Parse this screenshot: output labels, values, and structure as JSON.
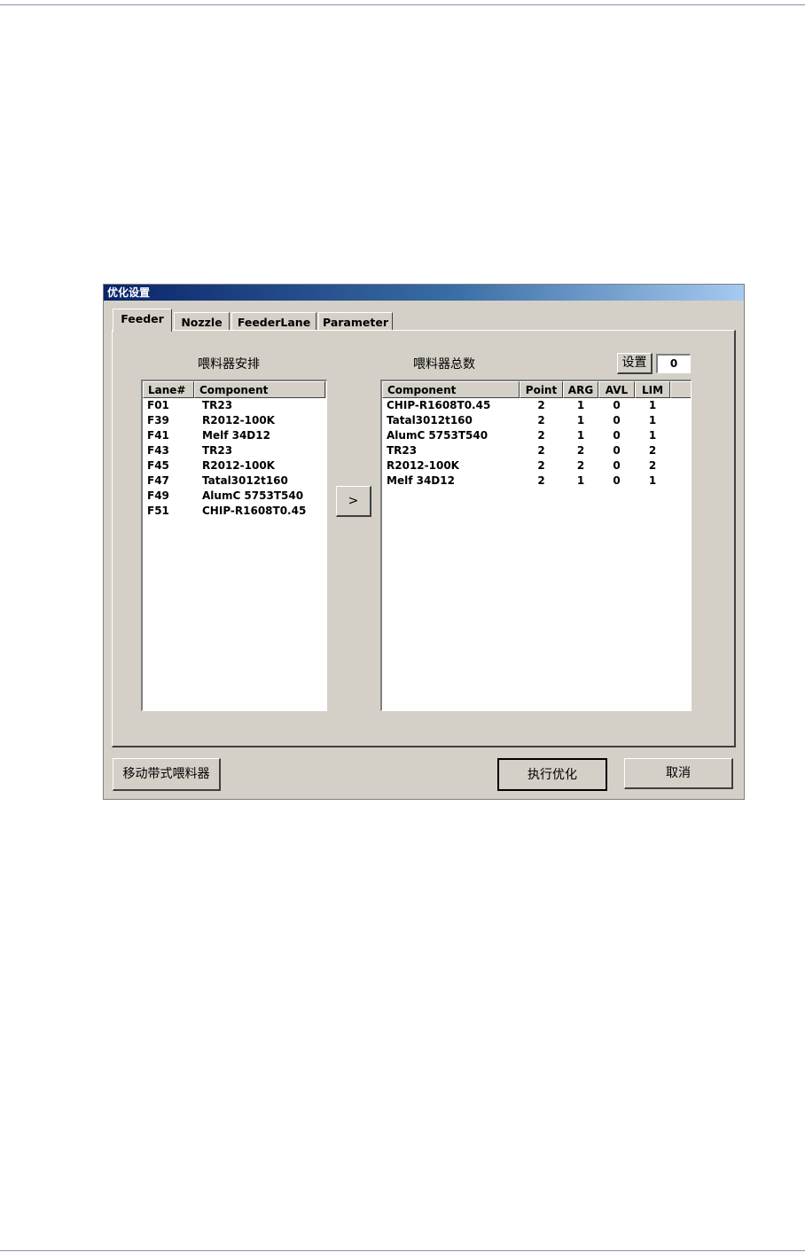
{
  "window": {
    "title": "优化设置"
  },
  "tabs": [
    {
      "label": "Feeder",
      "active": true
    },
    {
      "label": "Nozzle",
      "active": false
    },
    {
      "label": "FeederLane",
      "active": false
    },
    {
      "label": "Parameter",
      "active": false
    }
  ],
  "feeder_arrangement": {
    "caption": "喂料器安排",
    "columns": [
      "Lane#",
      "Component"
    ],
    "rows": [
      {
        "lane": "F01",
        "component": "TR23"
      },
      {
        "lane": "F39",
        "component": "R2012-100K"
      },
      {
        "lane": "F41",
        "component": "Melf 34D12"
      },
      {
        "lane": "F43",
        "component": "TR23"
      },
      {
        "lane": "F45",
        "component": "R2012-100K"
      },
      {
        "lane": "F47",
        "component": "Tatal3012t160"
      },
      {
        "lane": "F49",
        "component": "AlumC 5753T540"
      },
      {
        "lane": "F51",
        "component": "CHIP-R1608T0.45"
      }
    ]
  },
  "move_button": {
    "label": ">"
  },
  "feeder_totals": {
    "caption": "喂料器总数",
    "set_button": "设置",
    "set_value": "0",
    "columns": [
      "Component",
      "Point",
      "ARG",
      "AVL",
      "LIM"
    ],
    "rows": [
      {
        "component": "CHIP-R1608T0.45",
        "point": "2",
        "arg": "1",
        "avl": "0",
        "lim": "1"
      },
      {
        "component": "Tatal3012t160",
        "point": "2",
        "arg": "1",
        "avl": "0",
        "lim": "1"
      },
      {
        "component": "AlumC 5753T540",
        "point": "2",
        "arg": "1",
        "avl": "0",
        "lim": "1"
      },
      {
        "component": "TR23",
        "point": "2",
        "arg": "2",
        "avl": "0",
        "lim": "2"
      },
      {
        "component": "R2012-100K",
        "point": "2",
        "arg": "2",
        "avl": "0",
        "lim": "2"
      },
      {
        "component": "Melf 34D12",
        "point": "2",
        "arg": "1",
        "avl": "0",
        "lim": "1"
      }
    ]
  },
  "buttons": {
    "mobile_feeder": "移动带式喂料器",
    "run": "执行优化",
    "cancel": "取消"
  },
  "colors": {
    "dialog_bg": "#d4d0c8",
    "title_start": "#0a246a",
    "title_end": "#a6caf0"
  }
}
